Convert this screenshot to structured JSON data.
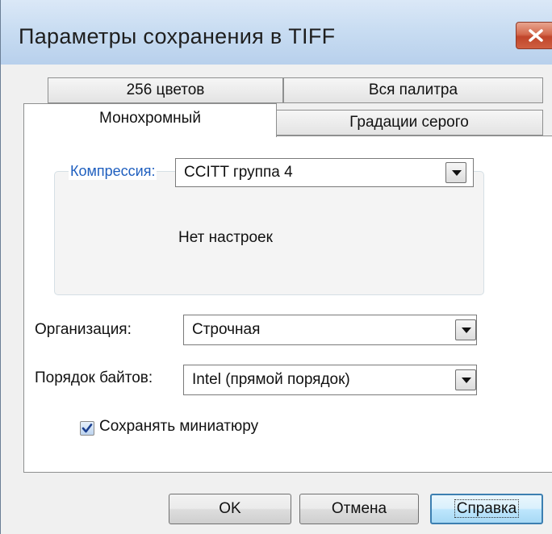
{
  "window": {
    "title": "Параметры сохранения в TIFF",
    "close_icon": "close-icon"
  },
  "tabs": {
    "row_back": [
      "256 цветов",
      "Вся палитра"
    ],
    "row_front": [
      "Монохромный",
      "Градации серого"
    ],
    "active": "Монохромный"
  },
  "compression": {
    "label": "Компрессия:",
    "value": "CCITT группа 4",
    "no_settings_text": "Нет настроек"
  },
  "organization": {
    "label": "Организация:",
    "value": "Строчная"
  },
  "byte_order": {
    "label": "Порядок байтов:",
    "value": "Intel (прямой порядок)"
  },
  "thumbnail": {
    "label": "Сохранять миниатюру",
    "checked": true
  },
  "buttons": {
    "ok": "OK",
    "cancel": "Отмена",
    "help": "Справка"
  },
  "colors": {
    "accent_label": "#1f5fbf",
    "close_button": "#c0452a"
  }
}
